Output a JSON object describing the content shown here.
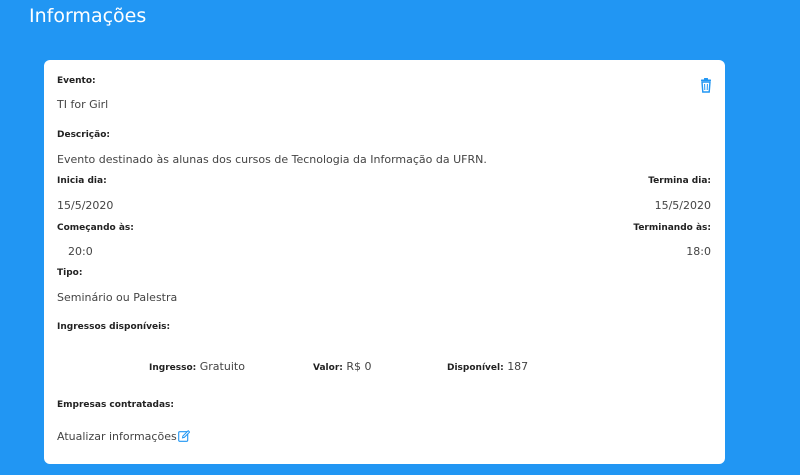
{
  "header": {
    "title": "Informações"
  },
  "event": {
    "name_label": "Evento:",
    "name": "TI for Girl",
    "description_label": "Descrição:",
    "description": "Evento destinado às alunas dos cursos de Tecnologia da Informação da UFRN.",
    "start_date_label": "Inicia dia:",
    "start_date": "15/5/2020",
    "end_date_label": "Termina dia:",
    "end_date": "15/5/2020",
    "start_time_label": "Começando às:",
    "start_time": "20:0",
    "end_time_label": "Terminando às:",
    "end_time": "18:0",
    "type_label": "Tipo:",
    "type": "Seminário ou Palestra"
  },
  "tickets": {
    "section_label": "Ingressos disponíveis:",
    "items": [
      {
        "ticket_label": "Ingresso:",
        "ticket_value": "Gratuito",
        "price_label": "Valor:",
        "price_value": "R$ 0",
        "available_label": "Disponível:",
        "available_value": "187"
      }
    ]
  },
  "companies": {
    "section_label": "Empresas contratadas:"
  },
  "actions": {
    "update_label": "Atualizar informações",
    "delete_icon": "trash-icon",
    "edit_icon": "edit-icon"
  },
  "colors": {
    "background": "#2196f3",
    "card": "#ffffff",
    "icon_accent": "#2196f3"
  }
}
